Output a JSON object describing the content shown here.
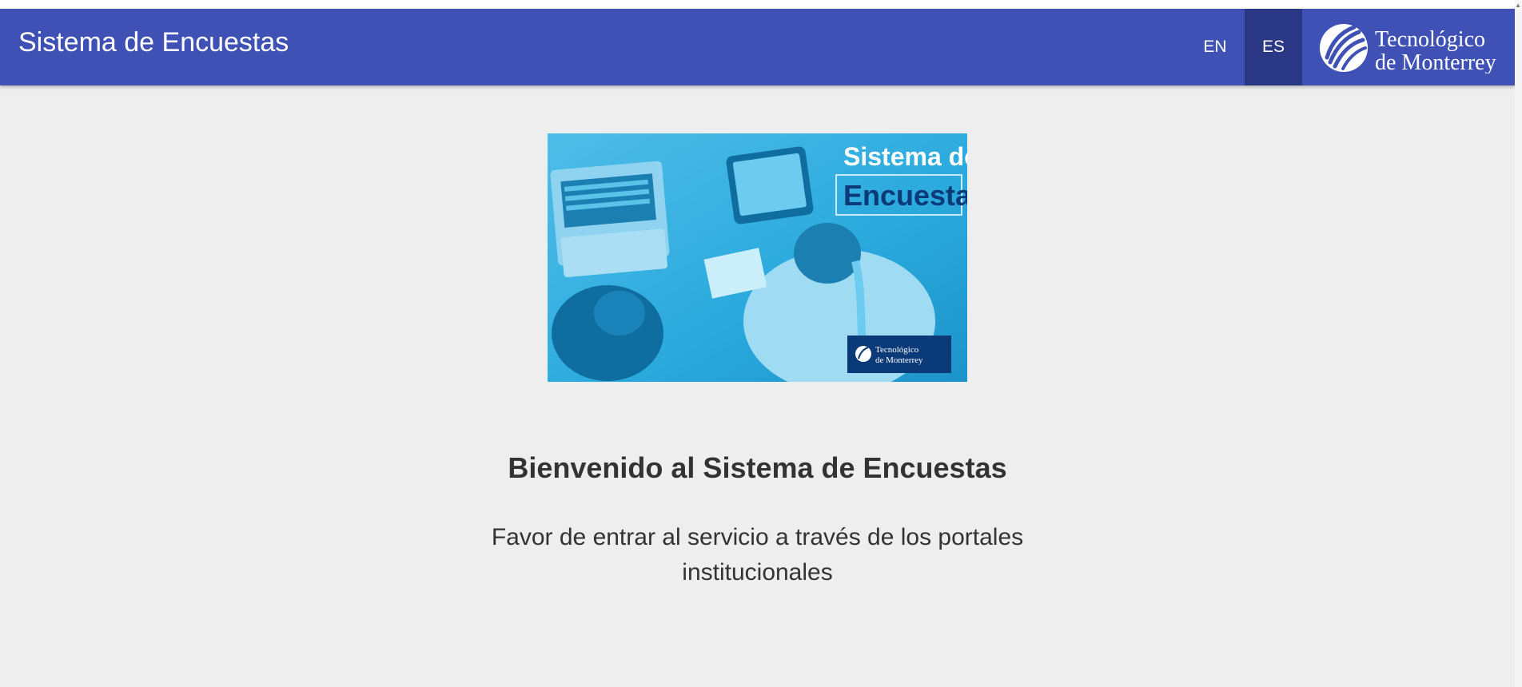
{
  "header": {
    "title": "Sistema de Encuestas",
    "languages": [
      {
        "code": "EN",
        "active": false
      },
      {
        "code": "ES",
        "active": true
      }
    ],
    "brand": {
      "line1": "Tecnológico",
      "line2": "de Monterrey",
      "icon": "tec-logo-icon"
    }
  },
  "hero": {
    "title_line1": "Sistema de",
    "title_line2": "Encuestas",
    "badge_line1": "Tecnológico",
    "badge_line2": "de Monterrey"
  },
  "main": {
    "welcome": "Bienvenido al Sistema de Encuestas",
    "message": "Favor de entrar al servicio a través de los portales institucionales"
  },
  "colors": {
    "toolbar": "#3f51b5",
    "active_language": "#2a3784",
    "background": "#eeeeee",
    "text": "#333333",
    "hero_blue": "#2aa9dd",
    "hero_navy": "#0b3a78"
  }
}
